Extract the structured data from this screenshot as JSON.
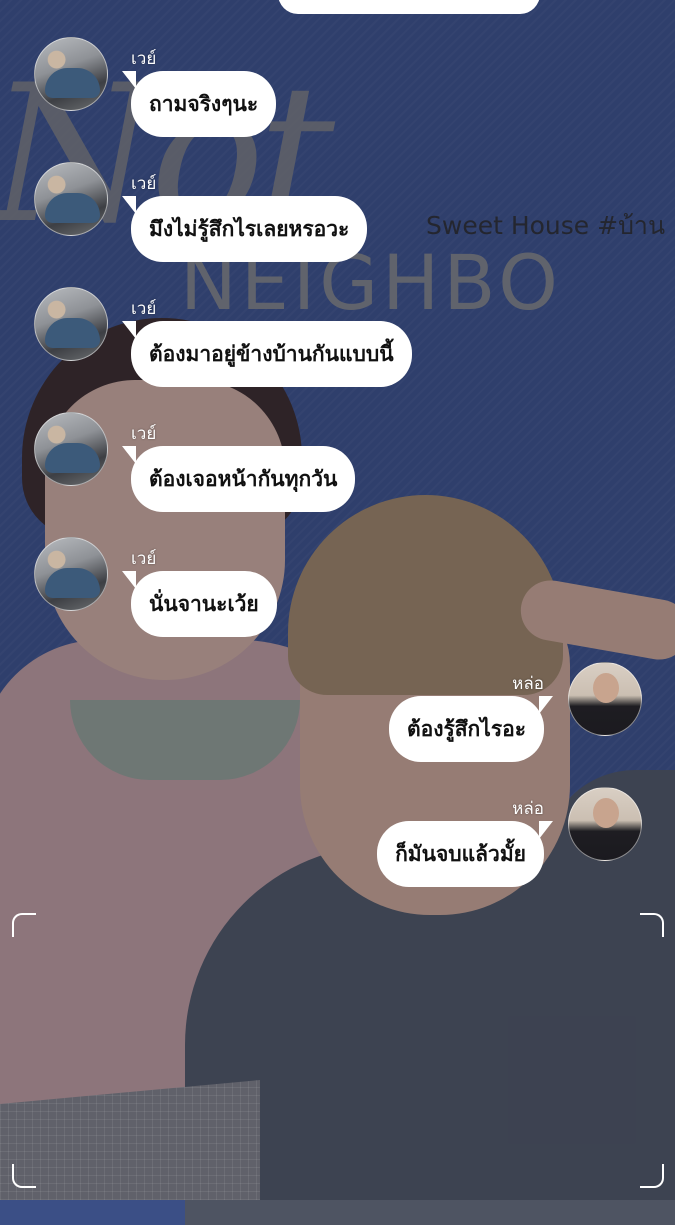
{
  "background": {
    "title": "Not",
    "subtitle": "NEIGHBO",
    "tagline": "Sweet House #บ้าน"
  },
  "messages": [
    {
      "side": "left",
      "sender": "เวย์",
      "text": "ถามจริงๆนะ"
    },
    {
      "side": "left",
      "sender": "เวย์",
      "text": "มึงไม่รู้สึกไรเลยหรอวะ"
    },
    {
      "side": "left",
      "sender": "เวย์",
      "text": "ต้องมาอยู่ข้างบ้านกันแบบนี้"
    },
    {
      "side": "left",
      "sender": "เวย์",
      "text": "ต้องเจอหน้ากันทุกวัน"
    },
    {
      "side": "left",
      "sender": "เวย์",
      "text": "นั่นจานะเว้ย"
    },
    {
      "side": "right",
      "sender": "หล่อ",
      "text": "ต้องรู้สึกไรอะ"
    },
    {
      "side": "right",
      "sender": "หล่อ",
      "text": "ก็มันจบแล้วมั้ย"
    }
  ],
  "colors": {
    "background": "#3b4f86",
    "bubble": "#ffffff",
    "text": "#111111"
  },
  "icons": {
    "sender_left_avatar": "avatar-wei",
    "sender_right_avatar": "avatar-lo"
  }
}
